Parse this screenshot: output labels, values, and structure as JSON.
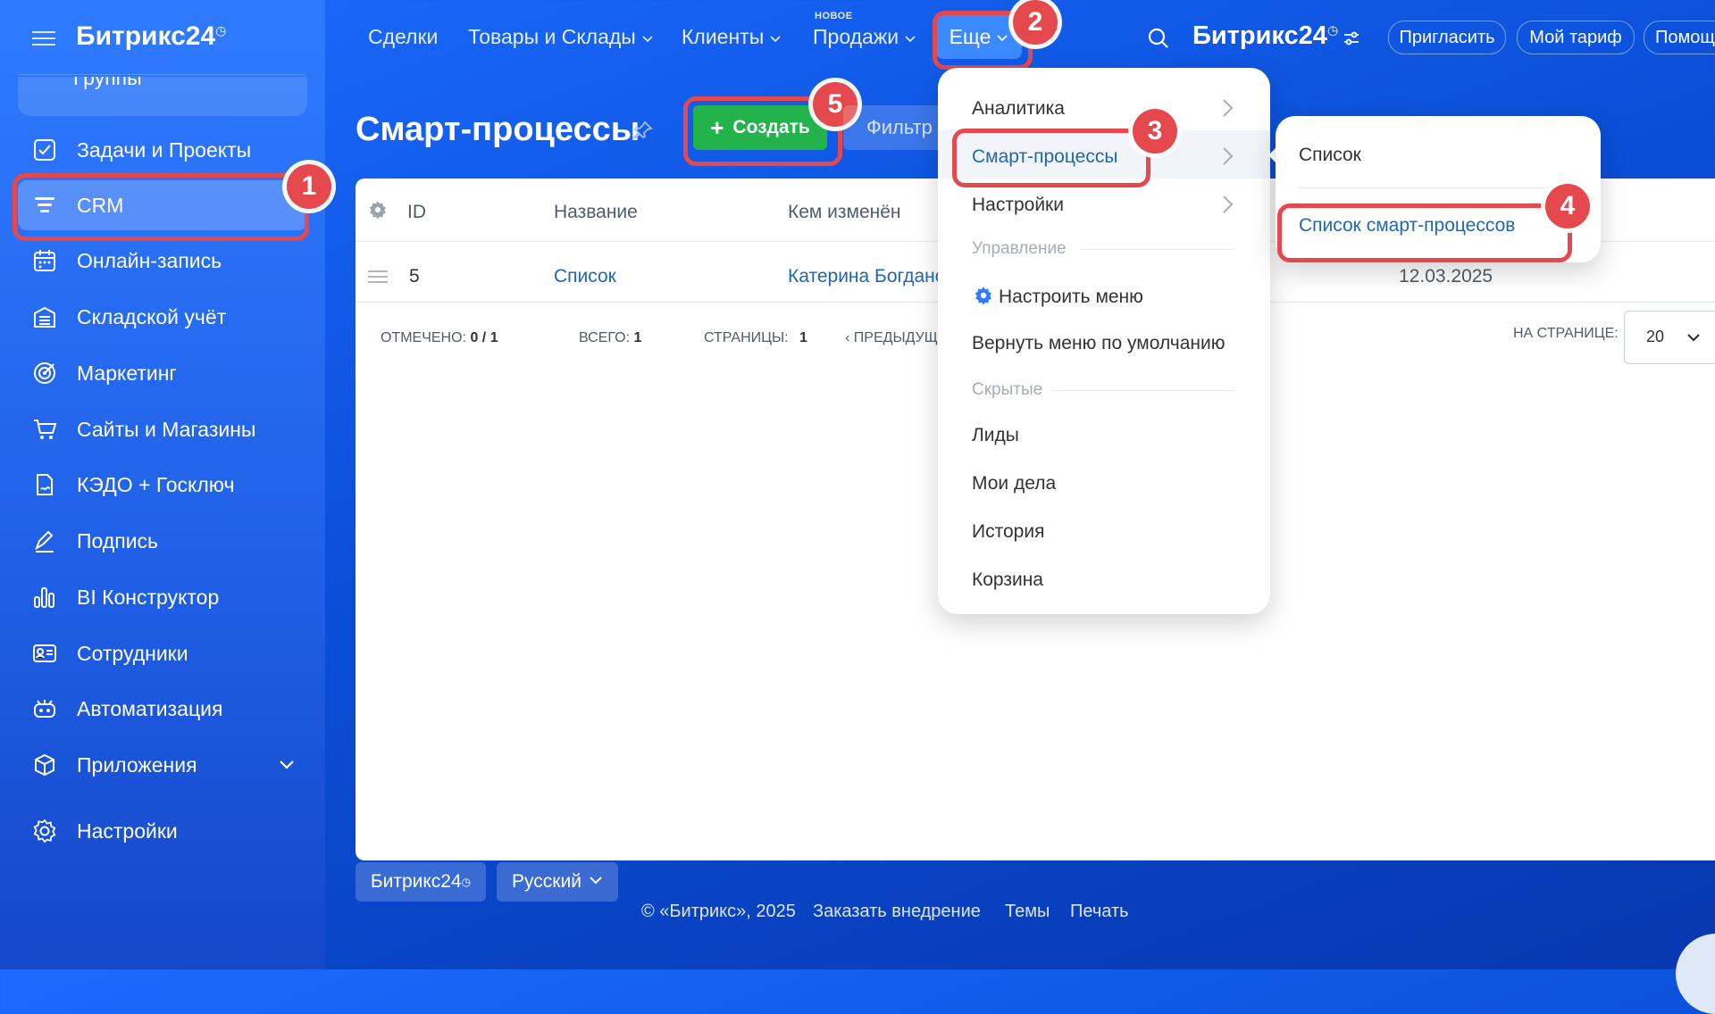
{
  "sidebar": {
    "brand": "Битрикс24",
    "brand_mark": "◷",
    "partial_item": "Группы",
    "items": [
      {
        "label": "Задачи и Проекты"
      },
      {
        "label": "CRM"
      },
      {
        "label": "Онлайн-запись"
      },
      {
        "label": "Складской учёт"
      },
      {
        "label": "Маркетинг"
      },
      {
        "label": "Сайты и Магазины"
      },
      {
        "label": "КЭДО + Госключ"
      },
      {
        "label": "Подпись"
      },
      {
        "label": "BI Конструктор"
      },
      {
        "label": "Сотрудники"
      },
      {
        "label": "Автоматизация"
      },
      {
        "label": "Приложения"
      },
      {
        "label": "Настройки"
      }
    ]
  },
  "topnav": {
    "items": [
      "Сделки",
      "Товары и Склады",
      "Клиенты",
      "Продажи"
    ],
    "new_badge": "НОВОЕ",
    "more": "Еще",
    "brand": "Битрикс24",
    "brand_mark": "◷",
    "invite": "Пригласить",
    "tariff": "Мой тариф",
    "help": "Помощь"
  },
  "page": {
    "title": "Смарт-процессы",
    "create": "Создать",
    "filter_placeholder": "Фильтр"
  },
  "table": {
    "columns": [
      "ID",
      "Название",
      "Кем изменён"
    ],
    "rows": [
      {
        "id": "5",
        "name": "Список",
        "modified_by": "Катерина Богданова",
        "date": "12.03.2025"
      }
    ],
    "stats": {
      "checked_label": "ОТМЕЧЕНО:",
      "checked_value": "0 / 1",
      "total_label": "ВСЕГО:",
      "total_value": "1",
      "pages_label": "СТРАНИЦЫ:",
      "pages_value": "1",
      "prev": "ПРЕДЫДУЩАЯ",
      "per_page_label": "НА СТРАНИЦЕ:",
      "per_page_value": "20"
    }
  },
  "menu": {
    "analytics": "Аналитика",
    "smart_processes": "Смарт-процессы",
    "settings": "Настройки",
    "section_manage": "Управление",
    "configure_menu": "Настроить меню",
    "reset_menu": "Вернуть меню по умолчанию",
    "section_hidden": "Скрытые",
    "leads": "Лиды",
    "my_tasks": "Мои дела",
    "history": "История",
    "trash": "Корзина"
  },
  "submenu": {
    "list": "Список",
    "smart_list": "Список смарт-процессов"
  },
  "badges": [
    "1",
    "2",
    "3",
    "4",
    "5"
  ],
  "footer": {
    "brand": "Битрикс24",
    "brand_mark": "◷",
    "language": "Русский",
    "copyright": "© «Битрикс», 2025",
    "order": "Заказать внедрение",
    "themes": "Темы",
    "print": "Печать"
  },
  "colors": {
    "accent_red": "#e5484d",
    "create_green": "#22b34c",
    "link_blue": "#2067b0"
  }
}
